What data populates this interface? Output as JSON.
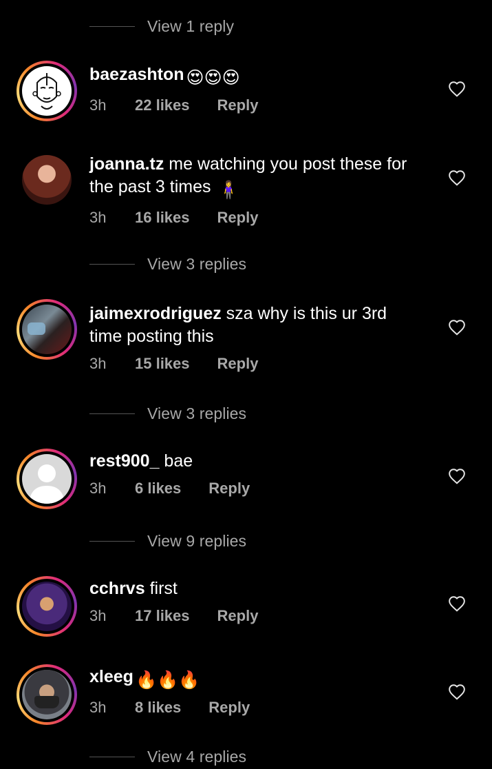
{
  "actions": {
    "like_icon": "heart-outline-icon"
  },
  "colors": {
    "background": "#000000",
    "secondary_text": "#a8a8a8",
    "story_ring_start": "#f58529",
    "story_ring_end": "#dd2a7b"
  },
  "top_thread": {
    "view_replies": "View 1 reply"
  },
  "comments": [
    {
      "username": "baezashton",
      "text": "",
      "emoji": "😍😍😍",
      "time": "3h",
      "likes": "22 likes",
      "reply": "Reply",
      "view_replies": ""
    },
    {
      "username": "joanna.tz",
      "text": " me watching you post these for the past 3 times",
      "emoji": "🧍‍♀️",
      "time": "3h",
      "likes": "16 likes",
      "reply": "Reply",
      "view_replies": "View 3 replies"
    },
    {
      "username": "jaimexrodriguez",
      "text": " sza why is this ur 3rd time posting this",
      "emoji": "",
      "time": "3h",
      "likes": "15 likes",
      "reply": "Reply",
      "view_replies": "View 3 replies"
    },
    {
      "username": "rest900_",
      "text": " bae",
      "emoji": "",
      "time": "3h",
      "likes": "6 likes",
      "reply": "Reply",
      "view_replies": "View 9 replies"
    },
    {
      "username": "cchrvs",
      "text": " first",
      "emoji": "",
      "time": "3h",
      "likes": "17 likes",
      "reply": "Reply",
      "view_replies": ""
    },
    {
      "username": "xleeg",
      "text": "",
      "emoji": "🔥🔥🔥",
      "time": "3h",
      "likes": "8 likes",
      "reply": "Reply",
      "view_replies": "View 4 replies"
    }
  ]
}
